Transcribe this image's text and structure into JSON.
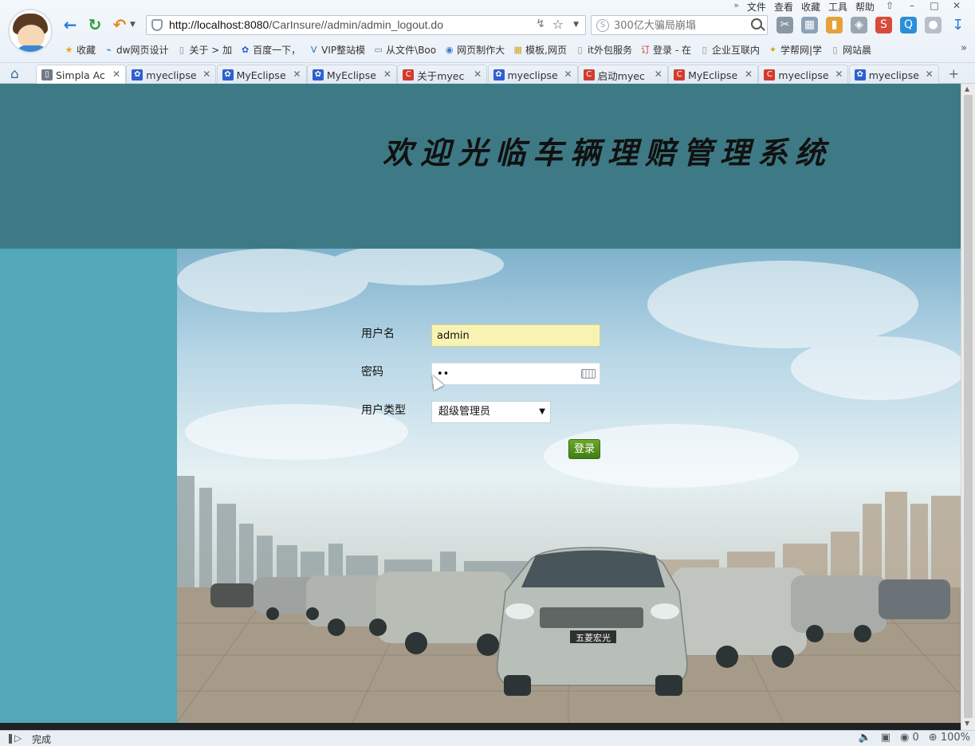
{
  "browser": {
    "menu": [
      "文件",
      "查看",
      "收藏",
      "工具",
      "帮助"
    ],
    "url": {
      "scheme_host": "http://localhost:8080",
      "path": "/CarInsure//admin/admin_logout.do"
    },
    "search_placeholder": "300亿大骗局崩塌",
    "bookmarks": [
      {
        "label": "收藏",
        "icon": "star-icon"
      },
      {
        "label": "dw网页设计",
        "icon": "link-icon"
      },
      {
        "label": "关于 > 加",
        "icon": "page-icon"
      },
      {
        "label": "百度一下，",
        "icon": "paw-icon"
      },
      {
        "label": "VIP整站模",
        "icon": "v-icon"
      },
      {
        "label": "从文件\\Boo",
        "icon": "folder-icon"
      },
      {
        "label": "网页制作大",
        "icon": "globe-icon"
      },
      {
        "label": "模板,网页",
        "icon": "template-icon"
      },
      {
        "label": "it外包服务",
        "icon": "page-icon"
      },
      {
        "label": "登录 - 在",
        "icon": "order-icon"
      },
      {
        "label": "企业互联内",
        "icon": "page-icon"
      },
      {
        "label": "学帮网|学",
        "icon": "gear-icon"
      },
      {
        "label": "网站晨",
        "icon": "page-icon"
      }
    ],
    "tabs": [
      {
        "title": "Simpla Ac",
        "icon": "page-icon",
        "active": true
      },
      {
        "title": "myeclipse",
        "icon": "paw-icon"
      },
      {
        "title": "MyEclipse",
        "icon": "paw-icon"
      },
      {
        "title": "MyEclipse",
        "icon": "paw-icon"
      },
      {
        "title": "关于myec",
        "icon": "c-icon"
      },
      {
        "title": "myeclipse",
        "icon": "paw-icon"
      },
      {
        "title": "启动myec",
        "icon": "c-icon"
      },
      {
        "title": "MyEclipse",
        "icon": "c-icon"
      },
      {
        "title": "myeclipse",
        "icon": "c-icon"
      },
      {
        "title": "myeclipse",
        "icon": "paw-icon"
      }
    ],
    "status": {
      "text": "完成",
      "block_count": "0",
      "zoom": "100%"
    }
  },
  "page": {
    "title": "欢迎光临车辆理赔管理系统",
    "form": {
      "username_label": "用户名",
      "username_value": "admin",
      "password_label": "密码",
      "password_value": "••",
      "usertype_label": "用户类型",
      "usertype_value": "超级管理员",
      "login_label": "登录"
    },
    "banner_plate": "五菱宏光"
  },
  "colors": {
    "header_bg": "#3e7a86",
    "side_bg": "#52a7b8",
    "login_button": "#4f8f1d",
    "username_bg": "#f8f3b3"
  }
}
